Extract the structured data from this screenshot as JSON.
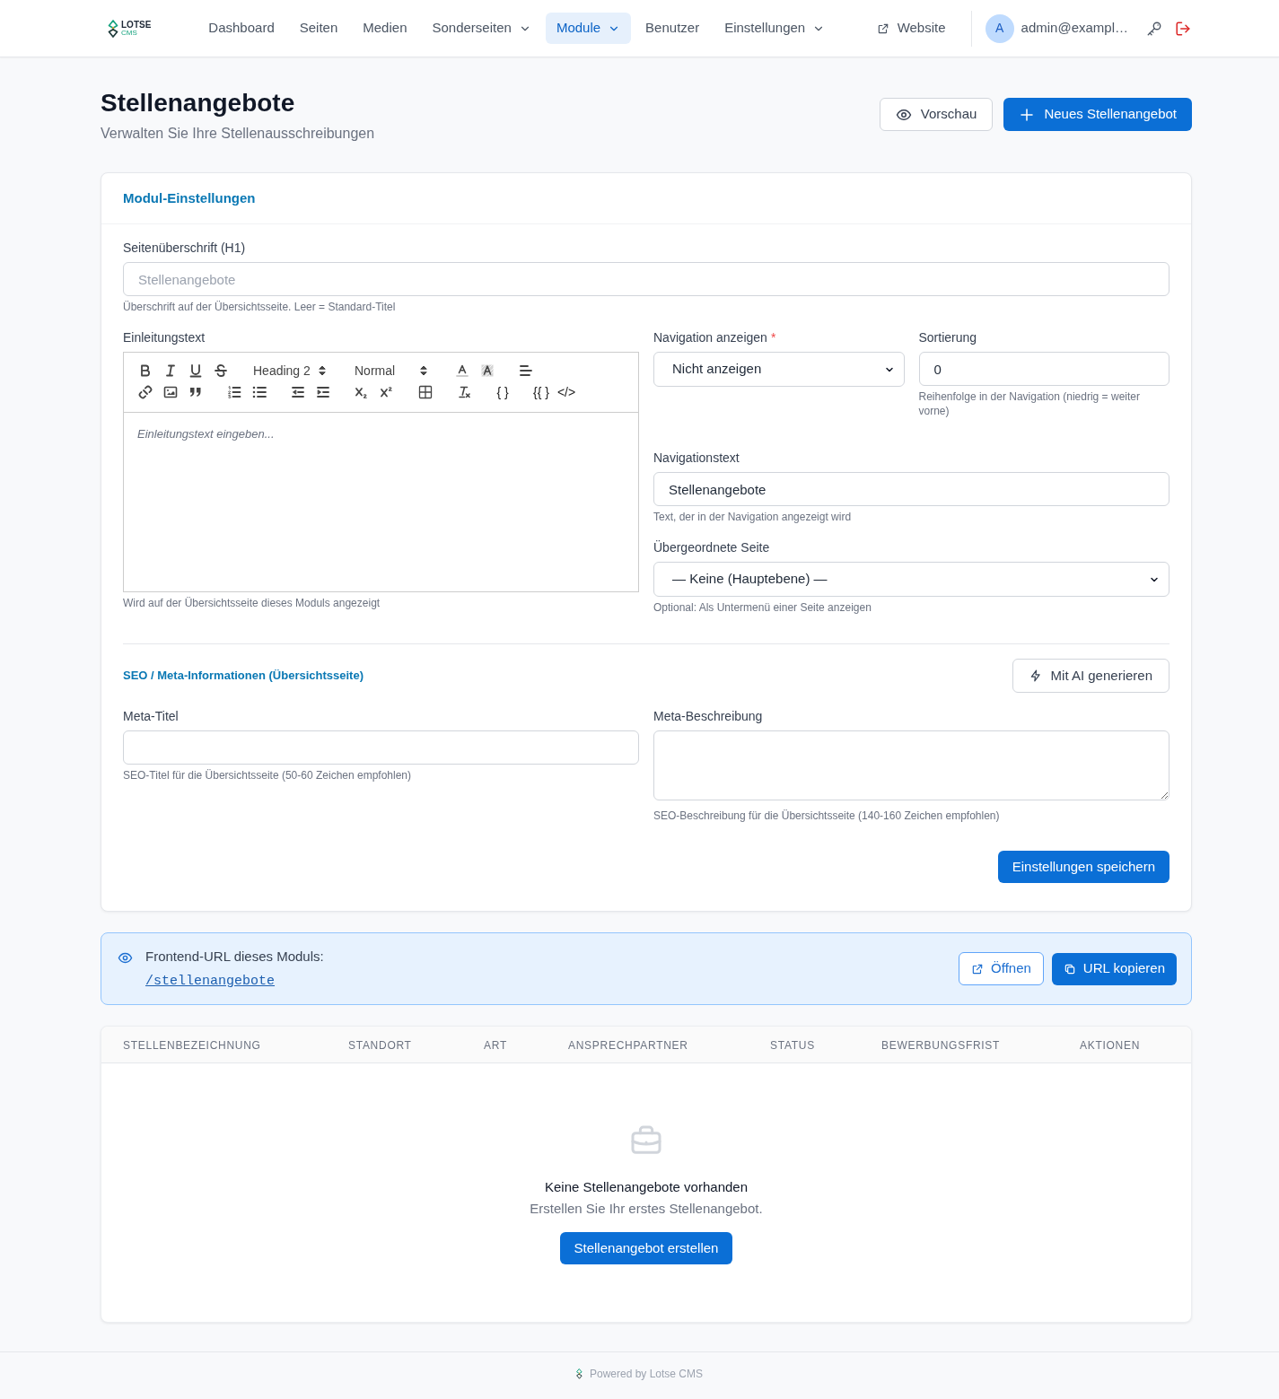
{
  "navbar": {
    "logo": {
      "name": "LOTSE",
      "sub": "CMS"
    },
    "items": [
      {
        "label": "Dashboard",
        "dropdown": false,
        "selected": false
      },
      {
        "label": "Seiten",
        "dropdown": false,
        "selected": false
      },
      {
        "label": "Medien",
        "dropdown": false,
        "selected": false
      },
      {
        "label": "Sonderseiten",
        "dropdown": true,
        "selected": false
      },
      {
        "label": "Module",
        "dropdown": true,
        "selected": true
      },
      {
        "label": "Benutzer",
        "dropdown": false,
        "selected": false
      },
      {
        "label": "Einstellungen",
        "dropdown": true,
        "selected": false
      }
    ],
    "website_link": "Website",
    "user": {
      "initial": "A",
      "email": "admin@exampl…"
    }
  },
  "page_header": {
    "title": "Stellenangebote",
    "subtitle": "Verwalten Sie Ihre Stellenausschreibungen",
    "buttons": [
      {
        "label": "Vorschau",
        "kind": "secondary"
      },
      {
        "label": "Neues Stellenangebot",
        "kind": "primary"
      }
    ]
  },
  "module_settings": {
    "title": "Modul-Einstellungen",
    "page_heading": {
      "label": "Seitenüberschrift (H1)",
      "placeholder": "Stellenangebote",
      "hint": "Überschrift auf der Übersichtsseite. Leer = Standard-Titel"
    },
    "intro_text": {
      "label": "Einleitungstext",
      "toolbar": {
        "heading": "Heading 2",
        "size": "Normal",
        "text_buttons": [
          "{ }",
          "{{ }",
          "</>"
        ]
      },
      "placeholder": "Einleitungstext eingeben...",
      "hint": "Wird auf der Übersichtsseite dieses Moduls angezeigt"
    },
    "show_in_navigation": {
      "label": "Navigation anzeigen",
      "required_mark": "*",
      "value": "Nicht anzeigen"
    },
    "sort_order": {
      "label": "Sortierung",
      "value": "0",
      "hint": "Reihenfolge in der Navigation (niedrig = weiter vorne)"
    },
    "navigation_text": {
      "label": "Navigationstext",
      "value": "Stellenangebote",
      "hint": "Text, der in der Navigation angezeigt wird"
    },
    "parent_page": {
      "label": "Übergeordnete Seite",
      "value": "— Keine (Hauptebene) —",
      "hint": "Optional: Als Untermenü einer Seite anzeigen"
    },
    "seo": {
      "title": "SEO / Meta-Informationen (Übersichtsseite)",
      "ai_button": "Mit AI generieren",
      "meta_title": {
        "label": "Meta-Titel",
        "hint": "SEO-Titel für die Übersichtsseite (50-60 Zeichen empfohlen)"
      },
      "meta_description": {
        "label": "Meta-Beschreibung",
        "hint": "SEO-Beschreibung für die Übersichtsseite (140-160 Zeichen empfohlen)"
      }
    },
    "save_button": "Einstellungen speichern"
  },
  "frontend_url": {
    "label": "Frontend-URL dieses Moduls:",
    "url": "/stellenangebote",
    "buttons": [
      {
        "label": "Öffnen",
        "kind": "secondary"
      },
      {
        "label": "URL kopieren",
        "kind": "primary"
      }
    ]
  },
  "jobs_table": {
    "columns": [
      "STELLENBEZEICHNUNG",
      "STANDORT",
      "ART",
      "ANSPRECHPARTNER",
      "STATUS",
      "BEWERBUNGSFRIST",
      "AKTIONEN"
    ],
    "empty_state": {
      "title": "Keine Stellenangebote vorhanden",
      "text": "Erstellen Sie Ihr erstes Stellenangebot.",
      "button": "Stellenangebot erstellen"
    }
  },
  "footer": {
    "text": "Powered by Lotse CMS"
  }
}
